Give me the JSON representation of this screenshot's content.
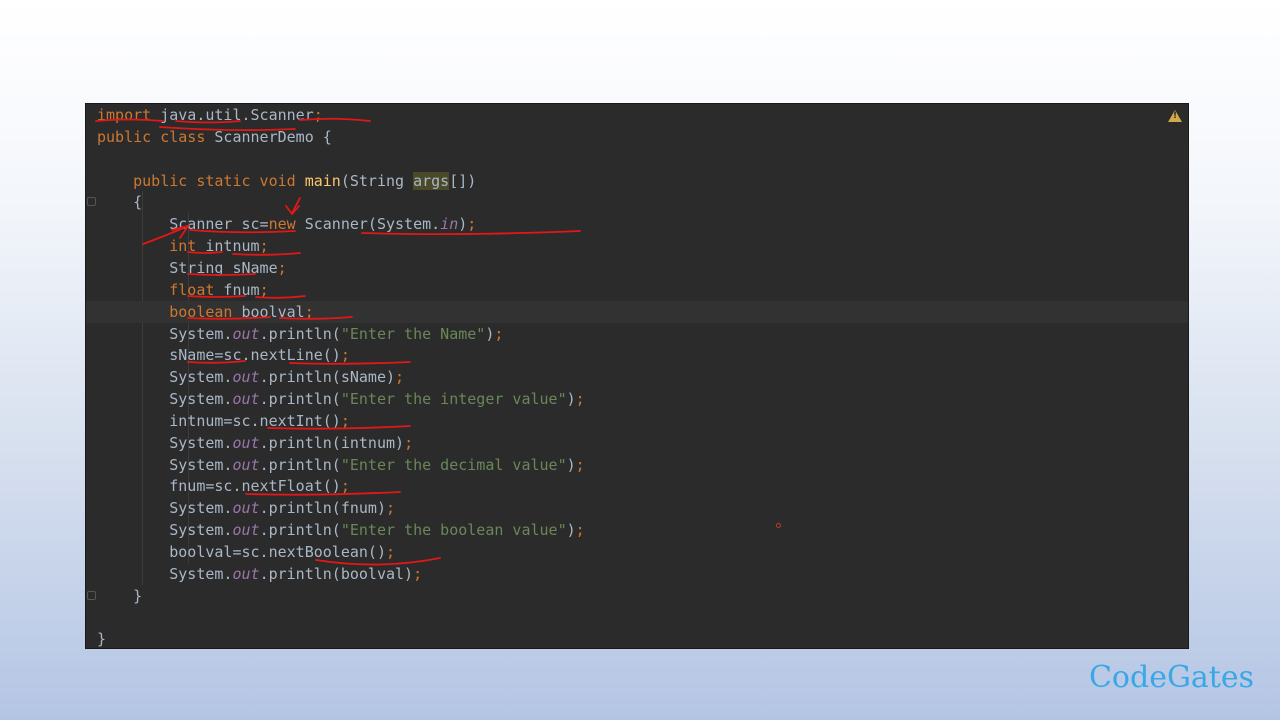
{
  "colors": {
    "editor_background": "#2b2b2b",
    "keyword": "#cc7832",
    "string": "#6a8759",
    "static_field": "#9876aa",
    "method_declaration": "#ffc66d",
    "default_text": "#a9b7c6",
    "annotation_ink": "#e01818",
    "brand": "#3aa7e6"
  },
  "editor": {
    "warning_icon": "warning-triangle-icon",
    "lines": [
      [
        {
          "t": "import",
          "c": "kw"
        },
        {
          "t": " java.util.Scanner"
        },
        {
          "t": ";",
          "c": "kw"
        }
      ],
      [
        {
          "t": "public class",
          "c": "kw"
        },
        {
          "t": " ScannerDemo {"
        }
      ],
      [],
      [
        {
          "t": "    "
        },
        {
          "t": "public static void",
          "c": "kw"
        },
        {
          "t": " "
        },
        {
          "t": "main",
          "c": "meth"
        },
        {
          "t": "(String "
        },
        {
          "t": "args",
          "c": "param-hl"
        },
        {
          "t": "[])"
        }
      ],
      [
        {
          "t": "    {"
        }
      ],
      [
        {
          "t": "        Scanner sc="
        },
        {
          "t": "new",
          "c": "kw"
        },
        {
          "t": " Scanner(System."
        },
        {
          "t": "in",
          "c": "fld"
        },
        {
          "t": ")"
        },
        {
          "t": ";",
          "c": "kw"
        }
      ],
      [
        {
          "t": "        "
        },
        {
          "t": "int",
          "c": "kw"
        },
        {
          "t": " intnum"
        },
        {
          "t": ";",
          "c": "kw"
        }
      ],
      [
        {
          "t": "        String sName"
        },
        {
          "t": ";",
          "c": "kw"
        }
      ],
      [
        {
          "t": "        "
        },
        {
          "t": "float",
          "c": "kw"
        },
        {
          "t": " fnum"
        },
        {
          "t": ";",
          "c": "kw"
        }
      ],
      [
        {
          "t": "        "
        },
        {
          "t": "boolean",
          "c": "kw"
        },
        {
          "t": " boolval"
        },
        {
          "t": ";",
          "c": "kw"
        }
      ],
      [
        {
          "t": "        System."
        },
        {
          "t": "out",
          "c": "fld"
        },
        {
          "t": ".println("
        },
        {
          "t": "\"Enter the Name\"",
          "c": "str"
        },
        {
          "t": ")"
        },
        {
          "t": ";",
          "c": "kw"
        }
      ],
      [
        {
          "t": "        sName=sc.nextLine()"
        },
        {
          "t": ";",
          "c": "kw"
        }
      ],
      [
        {
          "t": "        System."
        },
        {
          "t": "out",
          "c": "fld"
        },
        {
          "t": ".println(sName)"
        },
        {
          "t": ";",
          "c": "kw"
        }
      ],
      [
        {
          "t": "        System."
        },
        {
          "t": "out",
          "c": "fld"
        },
        {
          "t": ".println("
        },
        {
          "t": "\"Enter the integer value\"",
          "c": "str"
        },
        {
          "t": ")"
        },
        {
          "t": ";",
          "c": "kw"
        }
      ],
      [
        {
          "t": "        intnum=sc.nextInt()"
        },
        {
          "t": ";",
          "c": "kw"
        }
      ],
      [
        {
          "t": "        System."
        },
        {
          "t": "out",
          "c": "fld"
        },
        {
          "t": ".println(intnum)"
        },
        {
          "t": ";",
          "c": "kw"
        }
      ],
      [
        {
          "t": "        System."
        },
        {
          "t": "out",
          "c": "fld"
        },
        {
          "t": ".println("
        },
        {
          "t": "\"Enter the decimal value\"",
          "c": "str"
        },
        {
          "t": ")"
        },
        {
          "t": ";",
          "c": "kw"
        }
      ],
      [
        {
          "t": "        fnum=sc.nextFloat()"
        },
        {
          "t": ";",
          "c": "kw"
        }
      ],
      [
        {
          "t": "        System."
        },
        {
          "t": "out",
          "c": "fld"
        },
        {
          "t": ".println(fnum)"
        },
        {
          "t": ";",
          "c": "kw"
        }
      ],
      [
        {
          "t": "        System."
        },
        {
          "t": "out",
          "c": "fld"
        },
        {
          "t": ".println("
        },
        {
          "t": "\"Enter the boolean value\"",
          "c": "str"
        },
        {
          "t": ")"
        },
        {
          "t": ";",
          "c": "kw"
        }
      ],
      [
        {
          "t": "        boolval=sc.nextBoolean()"
        },
        {
          "t": ";",
          "c": "kw"
        }
      ],
      [
        {
          "t": "        System."
        },
        {
          "t": "out",
          "c": "fld"
        },
        {
          "t": ".println(boolval)"
        },
        {
          "t": ";",
          "c": "kw"
        }
      ],
      [
        {
          "t": "    }"
        }
      ],
      [],
      [
        {
          "t": "}"
        }
      ]
    ]
  },
  "brand": {
    "logo_text": "CodeGates"
  }
}
